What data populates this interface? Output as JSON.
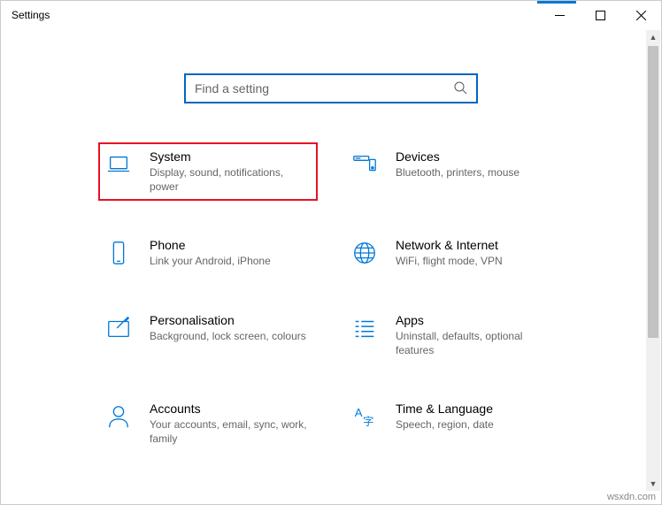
{
  "window": {
    "title": "Settings"
  },
  "search": {
    "placeholder": "Find a setting"
  },
  "categories": [
    {
      "key": "system",
      "title": "System",
      "desc": "Display, sound, notifications, power",
      "highlighted": true,
      "icon": "laptop-icon"
    },
    {
      "key": "devices",
      "title": "Devices",
      "desc": "Bluetooth, printers, mouse",
      "highlighted": false,
      "icon": "devices-icon"
    },
    {
      "key": "phone",
      "title": "Phone",
      "desc": "Link your Android, iPhone",
      "highlighted": false,
      "icon": "phone-icon"
    },
    {
      "key": "network",
      "title": "Network & Internet",
      "desc": "WiFi, flight mode, VPN",
      "highlighted": false,
      "icon": "globe-icon"
    },
    {
      "key": "personalisation",
      "title": "Personalisation",
      "desc": "Background, lock screen, colours",
      "highlighted": false,
      "icon": "paint-icon"
    },
    {
      "key": "apps",
      "title": "Apps",
      "desc": "Uninstall, defaults, optional features",
      "highlighted": false,
      "icon": "apps-icon"
    },
    {
      "key": "accounts",
      "title": "Accounts",
      "desc": "Your accounts, email, sync, work, family",
      "highlighted": false,
      "icon": "person-icon"
    },
    {
      "key": "time",
      "title": "Time & Language",
      "desc": "Speech, region, date",
      "highlighted": false,
      "icon": "language-icon"
    }
  ],
  "watermark": "wsxdn.com"
}
